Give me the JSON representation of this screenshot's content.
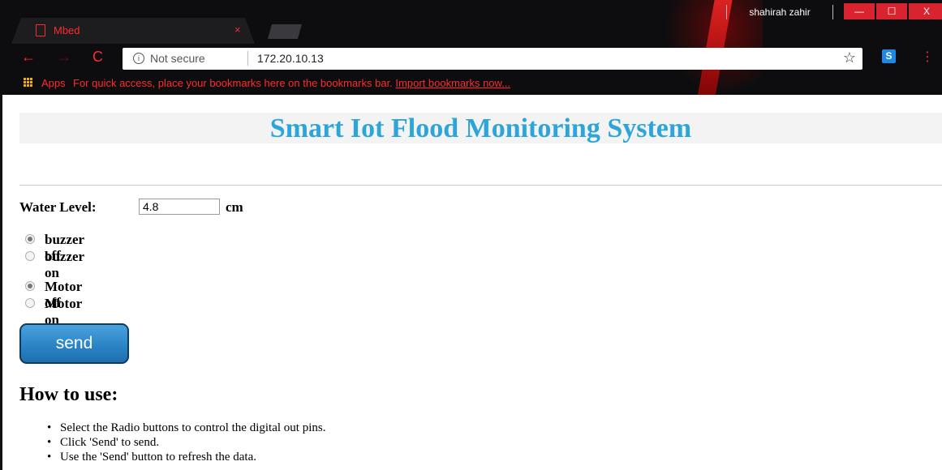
{
  "browser": {
    "tab_title": "Mbed",
    "tab_close": "×",
    "profile_name": "shahirah zahir",
    "window_controls": [
      "—",
      "☐",
      "X"
    ],
    "nav": {
      "back": "←",
      "forward": "→",
      "reload": "C"
    },
    "address_bar": {
      "security": "Not secure",
      "url": "172.20.10.13"
    },
    "bookmarks_bar": {
      "apps_label": "Apps",
      "hint": "For quick access, place your bookmarks here on the bookmarks bar. ",
      "import_link": "Import bookmarks now..."
    },
    "extension_label": "S",
    "menu_icon": "⋮",
    "colors": {
      "accent": "#ff2b2b",
      "chrome_bg": "#0d0d0f"
    }
  },
  "page": {
    "title": "Smart Iot Flood Monitoring System",
    "title_color": "#2ea5d8",
    "water_level": {
      "label": "Water Level:",
      "value": "4.8",
      "unit": "cm"
    },
    "buzzer": {
      "options": [
        {
          "label": "buzzer off",
          "checked": true
        },
        {
          "label": "buzzer on",
          "checked": false
        }
      ]
    },
    "motor": {
      "options": [
        {
          "label": "Motor off",
          "checked": true
        },
        {
          "label": "Motor on",
          "checked": false
        }
      ]
    },
    "send_label": "send",
    "howto": {
      "title": "How to use:",
      "items": [
        "Select the Radio buttons to control the digital out pins.",
        "Click 'Send' to send.",
        "Use the 'Send' button to refresh the data."
      ]
    }
  }
}
